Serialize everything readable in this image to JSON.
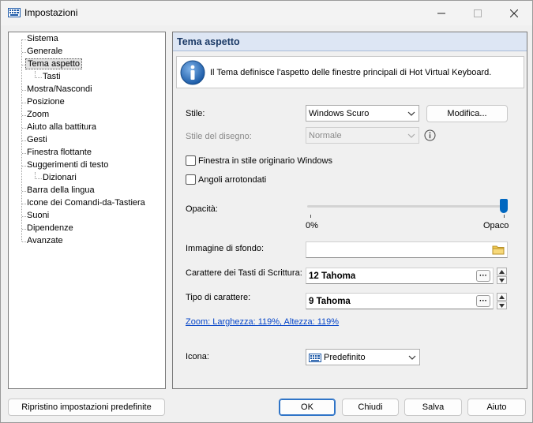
{
  "window": {
    "title": "Impostazioni",
    "icon": "keyboard-icon"
  },
  "tree": {
    "items": [
      {
        "label": "Sistema",
        "level": 0
      },
      {
        "label": "Generale",
        "level": 0
      },
      {
        "label": "Tema aspetto",
        "level": 0,
        "selected": true
      },
      {
        "label": "Tasti",
        "level": 1
      },
      {
        "label": "Mostra/Nascondi",
        "level": 0
      },
      {
        "label": "Posizione",
        "level": 0
      },
      {
        "label": "Zoom",
        "level": 0
      },
      {
        "label": "Aiuto alla battitura",
        "level": 0
      },
      {
        "label": "Gesti",
        "level": 0
      },
      {
        "label": "Finestra flottante",
        "level": 0
      },
      {
        "label": "Suggerimenti di testo",
        "level": 0
      },
      {
        "label": "Dizionari",
        "level": 1
      },
      {
        "label": "Barra della lingua",
        "level": 0
      },
      {
        "label": "Icone dei Comandi-da-Tastiera",
        "level": 0
      },
      {
        "label": "Suoni",
        "level": 0
      },
      {
        "label": "Dipendenze",
        "level": 0
      },
      {
        "label": "Avanzate",
        "level": 0
      }
    ]
  },
  "panel": {
    "title": "Tema aspetto",
    "info": "Il Tema definisce l'aspetto delle finestre principali di Hot Virtual Keyboard.",
    "style": {
      "label": "Stile:",
      "value": "Windows Scuro",
      "edit_button": "Modifica..."
    },
    "draw_style": {
      "label": "Stile del disegno:",
      "value": "Normale",
      "disabled": true
    },
    "native_style": {
      "label": "Finestra in stile originario Windows",
      "checked": false
    },
    "rounded": {
      "label": "Angoli arrotondati",
      "checked": false
    },
    "opacity": {
      "label": "Opacità:",
      "min_label": "0%",
      "max_label": "Opaco",
      "value_percent": 100
    },
    "background": {
      "label": "Immagine di sfondo:",
      "value": ""
    },
    "key_font": {
      "label": "Carattere dei Tasti di Scrittura:",
      "value": "12 Tahoma"
    },
    "font": {
      "label": "Tipo di carattere:",
      "value": "9 Tahoma"
    },
    "zoom_link": "Zoom: Larghezza: 119%, Altezza: 119%",
    "icon": {
      "label": "Icona:",
      "value": "Predefinito"
    }
  },
  "buttons": {
    "reset": "Ripristino impostazioni predefinite",
    "ok": "OK",
    "close": "Chiudi",
    "save": "Salva",
    "help": "Aiuto"
  },
  "colors": {
    "accent": "#0067c0",
    "panel_header_bg": "#dde6f4",
    "panel_header_text": "#1b3a66",
    "link": "#0645c8"
  },
  "dots_label": "···"
}
